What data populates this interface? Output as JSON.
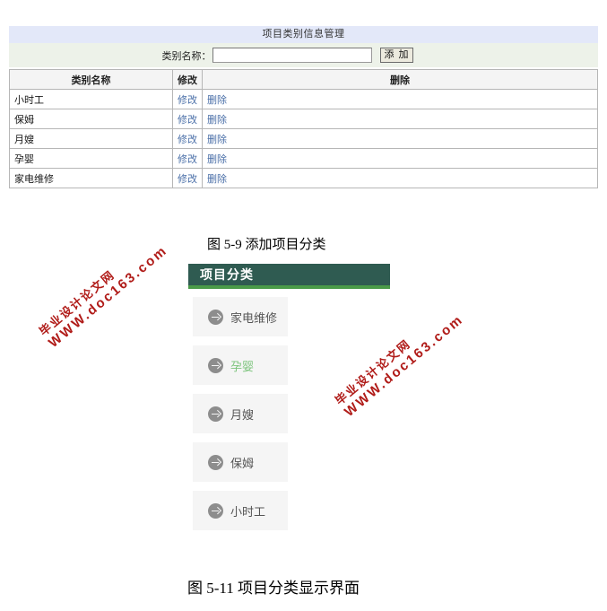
{
  "admin_screen": {
    "title": "项目类别信息管理",
    "form": {
      "label": "类别名称：",
      "input_value": "",
      "input_placeholder": "",
      "add_button": "添 加"
    },
    "table": {
      "headers": [
        "类别名称",
        "修改",
        "删除"
      ],
      "rows": [
        {
          "name": "小时工",
          "edit": "修改",
          "delete": "删除"
        },
        {
          "name": "保姆",
          "edit": "修改",
          "delete": "删除"
        },
        {
          "name": "月嫂",
          "edit": "修改",
          "delete": "删除"
        },
        {
          "name": "孕婴",
          "edit": "修改",
          "delete": "删除"
        },
        {
          "name": "家电维修",
          "edit": "修改",
          "delete": "删除"
        }
      ]
    }
  },
  "captions": {
    "figure_5_9": "图 5-9 添加项目分类",
    "figure_5_11": "图 5-11 项目分类显示界面"
  },
  "front_panel": {
    "header_title": "项目分类",
    "items": [
      {
        "label": "家电维修",
        "active": false
      },
      {
        "label": "孕婴",
        "active": true
      },
      {
        "label": "月嫂",
        "active": false
      },
      {
        "label": "保姆",
        "active": false
      },
      {
        "label": "小时工",
        "active": false
      }
    ]
  },
  "watermarks": {
    "line_cn": "毕业设计论文网",
    "line_url": "WWW.doc163.com"
  },
  "colors": {
    "admin_title_bar": "#e3e8f9",
    "admin_form_bar": "#edf2e9",
    "table_header": "#f4f4f4",
    "link": "#4a6fa8",
    "panel_header_bg": "#2f5b51",
    "panel_header_accent": "#4a9a48",
    "panel_item_bg": "#f5f5f5",
    "panel_item_active_text": "#7cc47c",
    "arrow_circle": "#8d8d8d",
    "watermark": "#b01b18"
  }
}
